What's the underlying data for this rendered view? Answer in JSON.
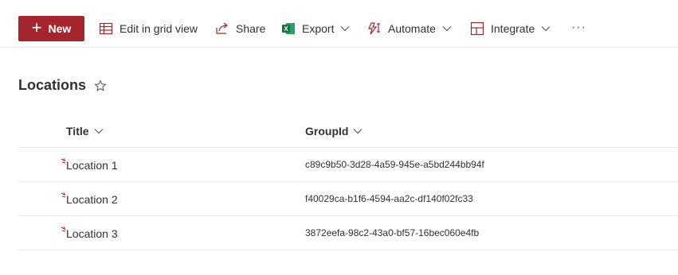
{
  "toolbar": {
    "new_label": "New",
    "edit_grid_label": "Edit in grid view",
    "share_label": "Share",
    "export_label": "Export",
    "automate_label": "Automate",
    "integrate_label": "Integrate",
    "more_label": "···"
  },
  "list": {
    "title": "Locations",
    "columns": [
      {
        "label": "Title"
      },
      {
        "label": "GroupId"
      }
    ],
    "rows": [
      {
        "title": "Location 1",
        "group_id": "c89c9b50-3d28-4a59-945e-a5bd244bb94f"
      },
      {
        "title": "Location 2",
        "group_id": "f40029ca-b1f6-4594-aa2c-df140f02fc33"
      },
      {
        "title": "Location 3",
        "group_id": "3872eefa-98c2-43a0-bf57-16bec060e4fb"
      }
    ]
  },
  "colors": {
    "accent": "#a4262c",
    "excel_green": "#1d6f42",
    "text": "#323130",
    "divider": "#edebe9"
  },
  "icons": {
    "new": "plus-icon",
    "edit_grid": "grid-icon",
    "share": "share-icon",
    "export": "excel-icon",
    "automate": "flow-icon",
    "integrate": "integrate-icon",
    "favorite": "star-icon",
    "sort": "chevron-down-icon",
    "new_item": "new-item-icon"
  }
}
